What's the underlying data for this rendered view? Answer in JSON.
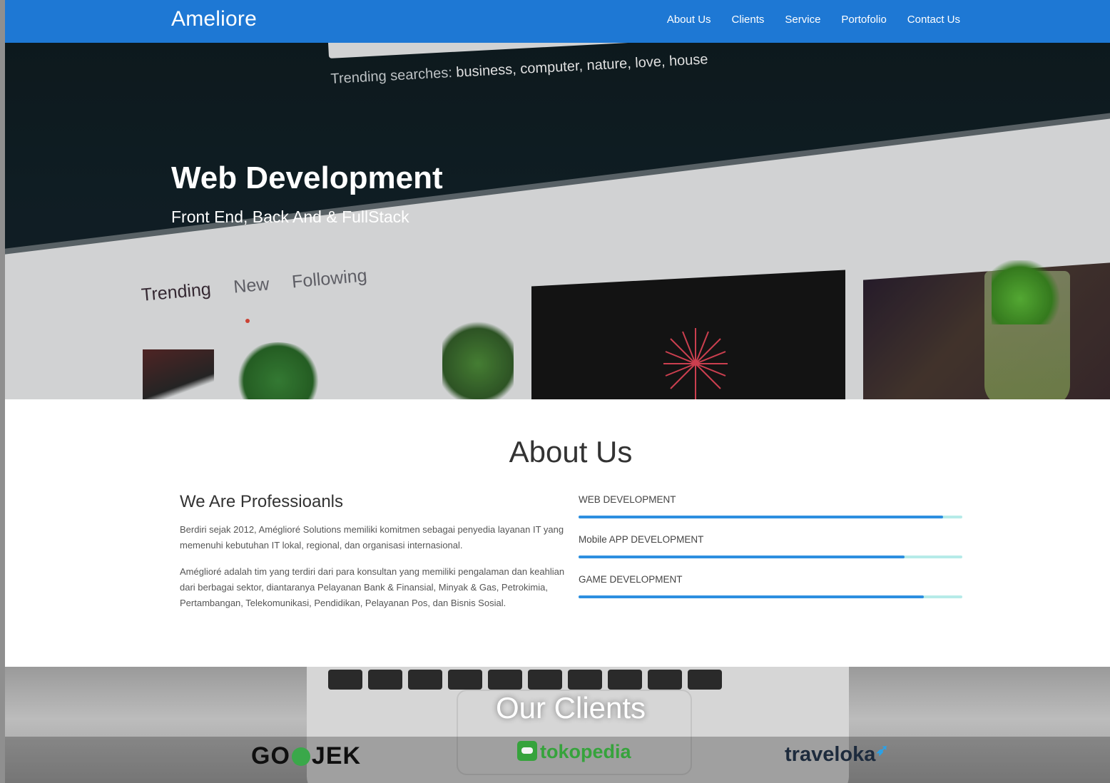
{
  "brand": "Ameliore",
  "nav": [
    "About Us",
    "Clients",
    "Service",
    "Portofolio",
    "Contact Us"
  ],
  "hero": {
    "title": "Web Development",
    "subtitle": "Front End, Back And & FullStack",
    "background_text": {
      "trending_prefix": "Trending searches:",
      "trending_terms": "business, computer, nature, love, house",
      "tabs": [
        "Trending",
        "New",
        "Following"
      ]
    }
  },
  "about": {
    "title": "About Us",
    "heading": "We Are Professioanls",
    "paragraphs": [
      "Berdiri sejak 2012, Améglioré Solutions memiliki komitmen sebagai penyedia layanan IT yang memenuhi kebutuhan IT lokal, regional, dan organisasi internasional.",
      "Améglioré adalah tim yang terdiri dari para konsultan yang memiliki pengalaman dan keahlian dari berbagai sektor, diantaranya Pelayanan Bank & Finansial, Minyak & Gas, Petrokimia, Pertambangan, Telekomunikasi, Pendidikan, Pelayanan Pos, dan Bisnis Sosial."
    ],
    "skills": [
      {
        "label": "WEB DEVELOPMENT",
        "level": 0.95
      },
      {
        "label": "Mobile APP DEVELOPMENT",
        "level": 0.85
      },
      {
        "label": "GAME DEVELOPMENT",
        "level": 0.9
      }
    ]
  },
  "clients": {
    "title": "Our Clients",
    "logos": [
      "GO-JEK",
      "tokopedia",
      "traveloka"
    ]
  },
  "colors": {
    "navbar": "#1e78d4",
    "skill_fill": "#2d8fe0",
    "skill_track": "#b6ebe8"
  }
}
